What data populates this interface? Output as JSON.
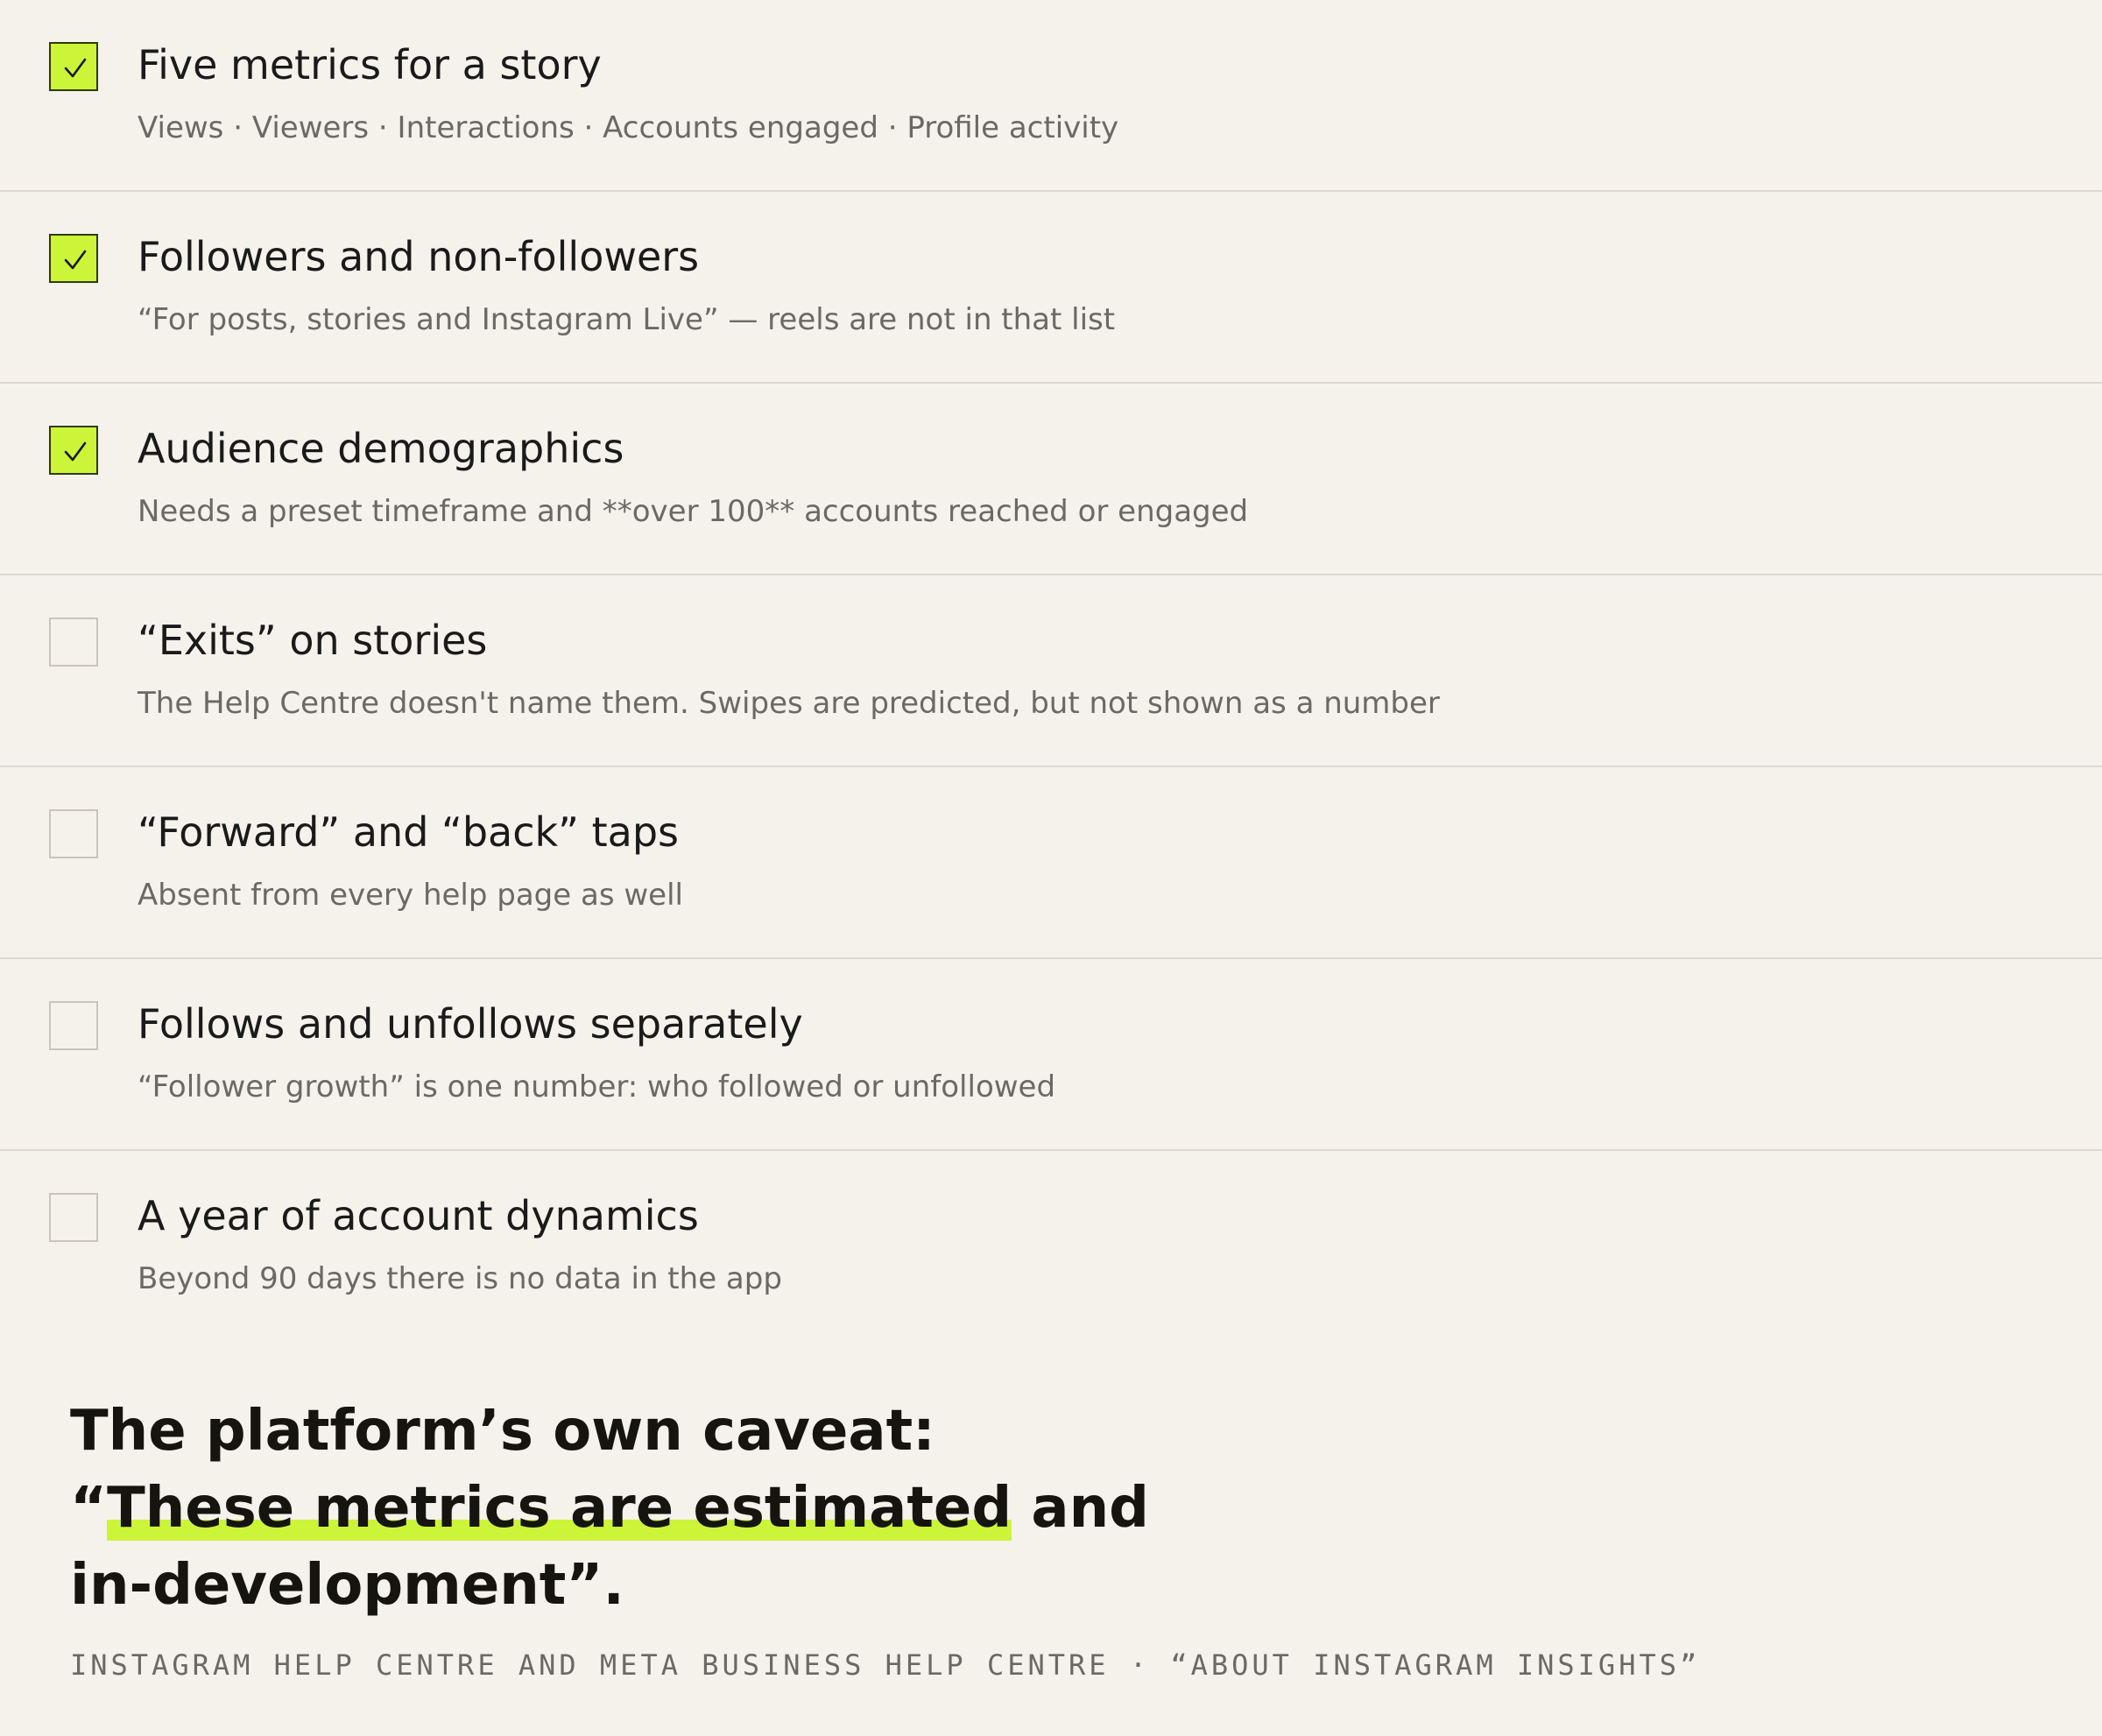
{
  "checklist": {
    "items": [
      {
        "title": "Five metrics for a story",
        "subtitle": "Views · Viewers · Interactions · Accounts engaged · Profile activity",
        "checked": true
      },
      {
        "title": "Followers and non-followers",
        "subtitle": "“For posts, stories and Instagram Live” — reels are not in that list",
        "checked": true
      },
      {
        "title": "Audience demographics",
        "subtitle": "Needs a preset timeframe and **over 100** accounts reached or engaged",
        "checked": true
      },
      {
        "title": "“Exits” on stories",
        "subtitle": "The Help Centre doesn't name them. Swipes are predicted, but not shown as a number",
        "checked": false
      },
      {
        "title": "“Forward” and “back” taps",
        "subtitle": "Absent from every help page as well",
        "checked": false
      },
      {
        "title": "Follows and unfollows separately",
        "subtitle": "“Follower growth” is one number: who followed or unfollowed",
        "checked": false
      },
      {
        "title": "A year of account dynamics",
        "subtitle": "Beyond 90 days there is no data in the app",
        "checked": false
      }
    ]
  },
  "quote": {
    "lead": "The platform’s own caveat: “",
    "highlight": "These metrics are estimated",
    "tail": " and in-development”."
  },
  "source": "INSTAGRAM HELP CENTRE AND META BUSINESS HELP CENTRE · “ABOUT INSTAGRAM INSIGHTS”",
  "colors": {
    "background": "#f5f2ec",
    "accent": "#ccf53a",
    "text": "#1a1a1a",
    "muted": "#6b6963",
    "divider": "#dcd8d1"
  },
  "icons": {
    "checked": "checkmark-icon"
  }
}
